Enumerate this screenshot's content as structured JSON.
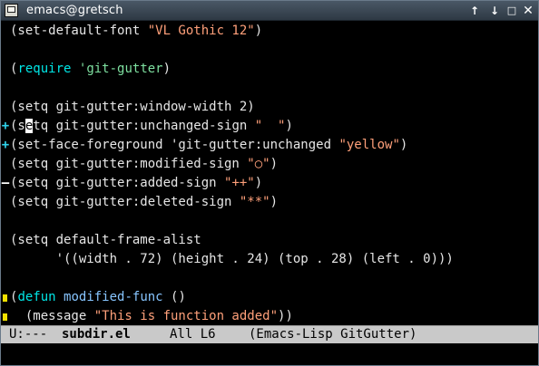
{
  "window": {
    "title": "emacs@gretsch",
    "buttons": {
      "up": "↑",
      "down": "↓",
      "maximize": "□",
      "close": "✕"
    }
  },
  "editor": {
    "lines": [
      {
        "fringe": "",
        "tokens": [
          {
            "t": "(set-default-font ",
            "c": ""
          },
          {
            "t": "\"VL Gothic 12\"",
            "c": "str"
          },
          {
            "t": ")",
            "c": ""
          }
        ]
      },
      {
        "fringe": "",
        "tokens": []
      },
      {
        "fringe": "",
        "tokens": [
          {
            "t": "(",
            "c": ""
          },
          {
            "t": "require",
            "c": "kw"
          },
          {
            "t": " ",
            "c": ""
          },
          {
            "t": "'git-gutter",
            "c": "const"
          },
          {
            "t": ")",
            "c": ""
          }
        ]
      },
      {
        "fringe": "",
        "tokens": []
      },
      {
        "fringe": "",
        "tokens": [
          {
            "t": "(setq git-gutter:window-width 2)",
            "c": ""
          }
        ]
      },
      {
        "fringe": "plus",
        "tokens": [
          {
            "t": "(s",
            "c": ""
          },
          {
            "t": "e",
            "c": "cursor"
          },
          {
            "t": "tq git-gutter:unchanged-sign ",
            "c": ""
          },
          {
            "t": "\"  \"",
            "c": "str"
          },
          {
            "t": ")",
            "c": ""
          }
        ]
      },
      {
        "fringe": "plus",
        "tokens": [
          {
            "t": "(set-face-foreground 'git-gutter:unchanged ",
            "c": ""
          },
          {
            "t": "\"yellow\"",
            "c": "str"
          },
          {
            "t": ")",
            "c": ""
          }
        ]
      },
      {
        "fringe": "",
        "tokens": [
          {
            "t": "(setq git-gutter:modified-sign ",
            "c": ""
          },
          {
            "t": "\"○\"",
            "c": "str"
          },
          {
            "t": ")",
            "c": ""
          }
        ]
      },
      {
        "fringe": "minus",
        "tokens": [
          {
            "t": "(setq git-gutter:added-sign ",
            "c": ""
          },
          {
            "t": "\"++\"",
            "c": "str"
          },
          {
            "t": ")",
            "c": ""
          }
        ]
      },
      {
        "fringe": "",
        "tokens": [
          {
            "t": "(setq git-gutter:deleted-sign ",
            "c": ""
          },
          {
            "t": "\"**\"",
            "c": "str"
          },
          {
            "t": ")",
            "c": ""
          }
        ]
      },
      {
        "fringe": "",
        "tokens": []
      },
      {
        "fringe": "",
        "tokens": [
          {
            "t": "(setq default-frame-alist",
            "c": ""
          }
        ]
      },
      {
        "fringe": "",
        "tokens": [
          {
            "t": "      '((width . 72) (height . 24) (top . 28) (left . 0)))",
            "c": ""
          }
        ]
      },
      {
        "fringe": "",
        "tokens": []
      },
      {
        "fringe": "mod",
        "tokens": [
          {
            "t": "(",
            "c": ""
          },
          {
            "t": "defun",
            "c": "kw"
          },
          {
            "t": " ",
            "c": ""
          },
          {
            "t": "modified-func",
            "c": "fn"
          },
          {
            "t": " ()",
            "c": ""
          }
        ]
      },
      {
        "fringe": "mod",
        "tokens": [
          {
            "t": "  (message ",
            "c": ""
          },
          {
            "t": "\"This is function added\"",
            "c": "str"
          },
          {
            "t": "))",
            "c": ""
          }
        ]
      }
    ]
  },
  "modeline": {
    "status": "U:---",
    "buffer": "subdir.el",
    "position": "All L6",
    "modes": "(Emacs-Lisp GitGutter)"
  },
  "minibuffer": {
    "text": ""
  },
  "colors": {
    "background": "#000000",
    "foreground": "#e6e6e6",
    "keyword": "#00e6e6",
    "string": "#ffa07a",
    "constant": "#7ee0a0",
    "function_name": "#87c5ff",
    "gutter_added": "#2fd4ee",
    "gutter_modified": "#f0e000",
    "modeline_bg": "#c9c9c9"
  },
  "icons": {
    "window_icon": "emacs-window-icon",
    "up": "arrow-up-icon",
    "down": "arrow-down-icon",
    "maximize": "maximize-icon",
    "close": "close-icon"
  }
}
